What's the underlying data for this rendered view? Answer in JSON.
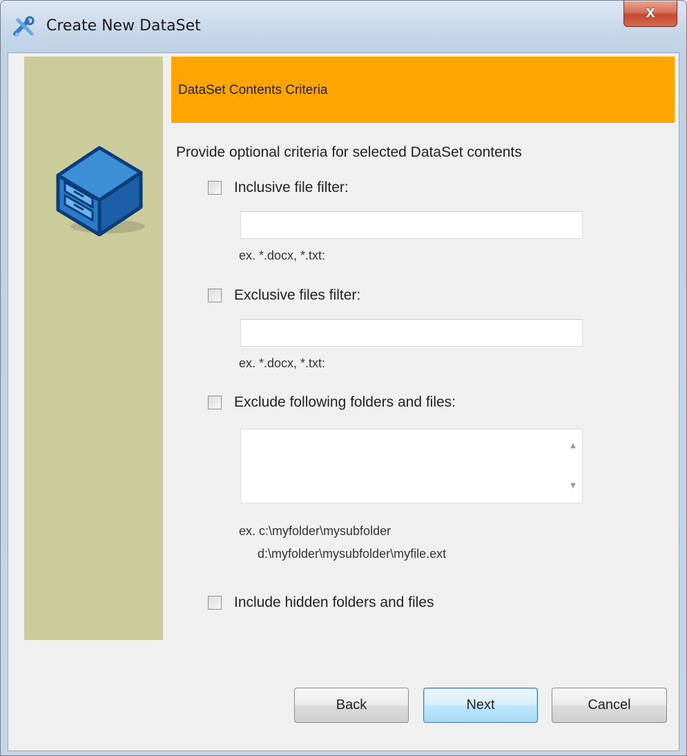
{
  "window": {
    "title": "Create New DataSet",
    "close_glyph": "x",
    "icons": {
      "app": "tools-icon",
      "close": "close-icon"
    }
  },
  "left_panel": {
    "icon": "file-cabinet-icon",
    "color": "#cbcb9c"
  },
  "header": {
    "title": "DataSet Contents Criteria",
    "color": "#ffa500"
  },
  "intro": "Provide optional criteria for selected DataSet contents",
  "inclusive_filter": {
    "checked": false,
    "label": "Inclusive file filter:",
    "value": "",
    "hint": "ex. *.docx, *.txt:"
  },
  "exclusive_filter": {
    "checked": false,
    "label": "Exclusive files filter:",
    "value": "",
    "hint": "ex. *.docx, *.txt:"
  },
  "exclude_paths": {
    "checked": false,
    "label": "Exclude following folders and files:",
    "value": "",
    "hint_line1": "ex. c:\\myfolder\\mysubfolder",
    "hint_line2": "d:\\myfolder\\mysubfolder\\myfile.ext",
    "scroll_up": "▲",
    "scroll_down": "▼"
  },
  "include_hidden": {
    "checked": false,
    "label": "Include hidden folders and files"
  },
  "buttons": {
    "back": "Back",
    "next": "Next",
    "cancel": "Cancel"
  }
}
